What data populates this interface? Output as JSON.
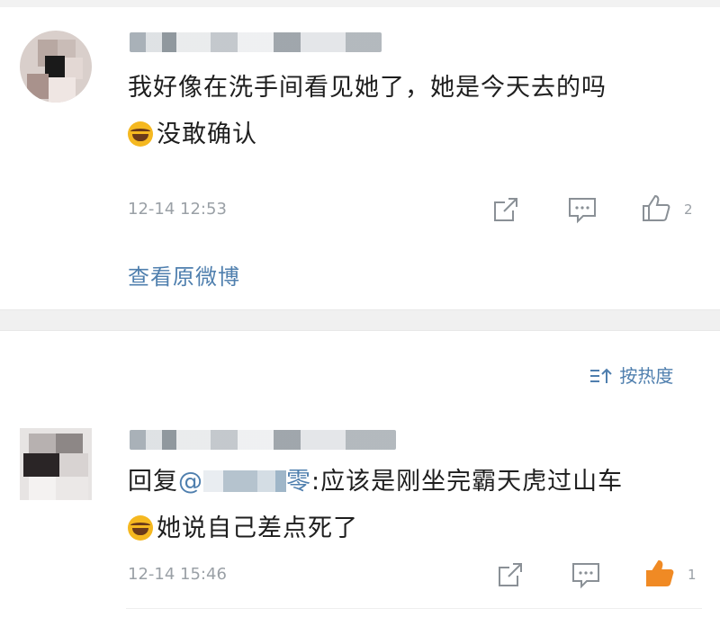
{
  "comments": [
    {
      "text": "我好像在洗手间看见她了，她是今天去的吗",
      "text_line2": "没敢确认",
      "time": "12-14 12:53",
      "likes": "2",
      "view_original": "查看原微博"
    },
    {
      "reply_prefix": "回复",
      "mention_at": "@",
      "mention_tail": "零",
      "text": "应该是刚坐完霸天虎过山车",
      "text_line2": "她说自己差点死了",
      "time": "12-14 15:46",
      "likes": "1"
    }
  ],
  "sort": {
    "label": "按热度"
  },
  "colors": {
    "link": "#4f7fae",
    "like_active": "#f08a24",
    "icon_gray": "#8a9096"
  },
  "icons": [
    "share-icon",
    "comment-icon",
    "like-icon",
    "sort-icon",
    "laugh-cry-emoji"
  ]
}
